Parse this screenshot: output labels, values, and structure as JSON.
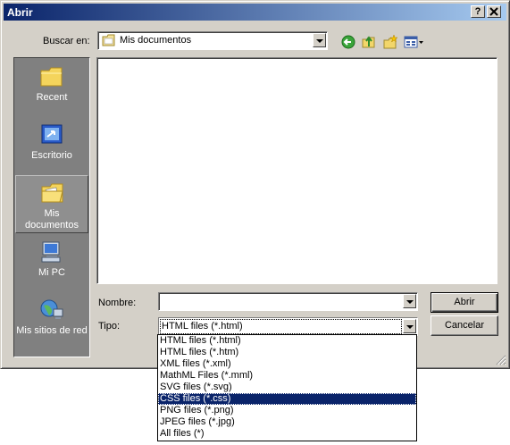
{
  "window": {
    "title": "Abrir",
    "help_glyph": "?",
    "close_glyph": "✕"
  },
  "lookin": {
    "label": "Buscar en:",
    "value": "Mis documentos"
  },
  "places": [
    {
      "label": "Recent"
    },
    {
      "label": "Escritorio"
    },
    {
      "label": "Mis documentos"
    },
    {
      "label": "Mi PC"
    },
    {
      "label": "Mis sitios de red"
    }
  ],
  "filename": {
    "label": "Nombre:",
    "value": ""
  },
  "filetype": {
    "label": "Tipo:",
    "value": "HTML files (*.html)",
    "options": [
      "HTML files (*.html)",
      "HTML files (*.htm)",
      "XML files (*.xml)",
      "MathML Files (*.mml)",
      "SVG files (*.svg)",
      "CSS files (*.css)",
      "PNG files (*.png)",
      "JPEG files (*.jpg)",
      "All files (*)"
    ],
    "highlighted": "CSS files (*.css)"
  },
  "buttons": {
    "open": "Abrir",
    "cancel": "Cancelar"
  },
  "colors": {
    "titlebar_start": "#0a246a",
    "titlebar_end": "#a6caf0",
    "face": "#d4d0c8",
    "selection": "#0a246a"
  }
}
